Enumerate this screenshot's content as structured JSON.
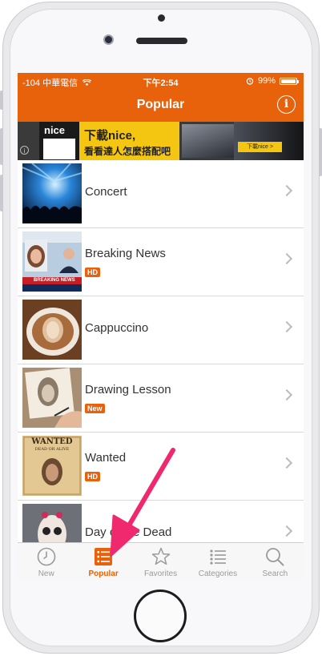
{
  "status_bar": {
    "carrier": "-104 中華電信",
    "time": "下午2:54",
    "battery": "99%",
    "battery_level": 0.99
  },
  "nav": {
    "title": "Popular",
    "info_icon": "info-icon"
  },
  "ad": {
    "brand": "nice",
    "headline": "下載nice,",
    "subline": "看看達人怎麼搭配吧",
    "cta": "下載nice >"
  },
  "list": [
    {
      "title": "Concert",
      "badge": null
    },
    {
      "title": "Breaking News",
      "badge": "HD"
    },
    {
      "title": "Cappuccino",
      "badge": null
    },
    {
      "title": "Drawing Lesson",
      "badge": "New"
    },
    {
      "title": "Wanted",
      "badge": "HD"
    },
    {
      "title": "Day of the Dead",
      "badge": null
    }
  ],
  "thumbs": {
    "breaking_news_banner": "BREAKING NEWS",
    "wanted_line1": "WANTED",
    "wanted_line2": "DEAD OR ALIVE"
  },
  "tabs": [
    {
      "label": "New",
      "icon": "clock-icon",
      "active": false
    },
    {
      "label": "Popular",
      "icon": "list-icon",
      "active": true
    },
    {
      "label": "Favorites",
      "icon": "star-icon",
      "active": false
    },
    {
      "label": "Categories",
      "icon": "bullet-list-icon",
      "active": false
    },
    {
      "label": "Search",
      "icon": "search-icon",
      "active": false
    }
  ],
  "colors": {
    "accent": "#e8620c",
    "annotation_arrow": "#f0286e"
  }
}
